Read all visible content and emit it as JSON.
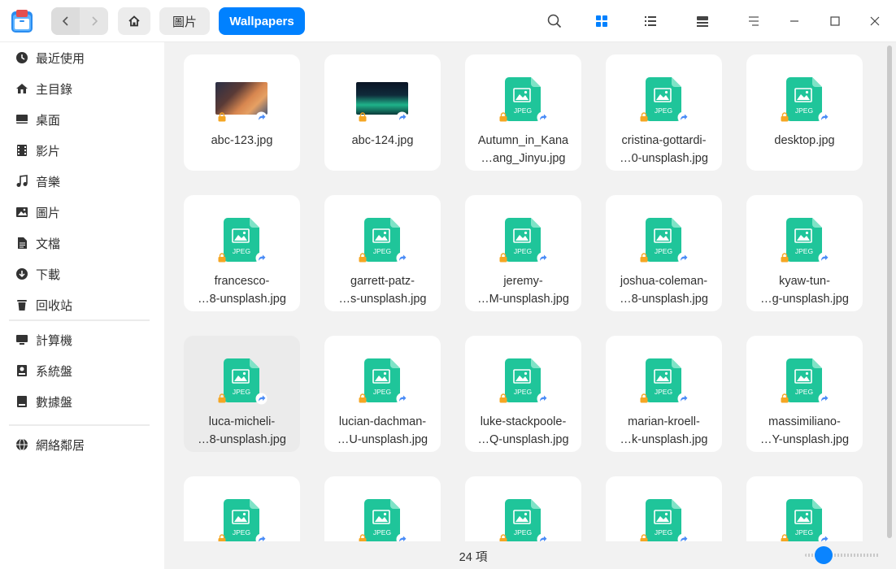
{
  "breadcrumb": {
    "parent": "圖片",
    "current": "Wallpapers"
  },
  "sidebar": {
    "group1": [
      {
        "label": "最近使用",
        "icon": "clock-icon"
      },
      {
        "label": "主目錄",
        "icon": "home-icon"
      },
      {
        "label": "桌面",
        "icon": "desktop-icon"
      },
      {
        "label": "影片",
        "icon": "video-icon"
      },
      {
        "label": "音樂",
        "icon": "music-icon"
      },
      {
        "label": "圖片",
        "icon": "picture-icon"
      },
      {
        "label": "文檔",
        "icon": "document-icon"
      },
      {
        "label": "下載",
        "icon": "download-icon"
      },
      {
        "label": "回收站",
        "icon": "trash-icon"
      }
    ],
    "group2": [
      {
        "label": "計算機",
        "icon": "computer-icon"
      },
      {
        "label": "系統盤",
        "icon": "system-disk-icon"
      },
      {
        "label": "數據盤",
        "icon": "data-disk-icon"
      }
    ],
    "group3": [
      {
        "label": "網絡鄰居",
        "icon": "network-icon"
      }
    ]
  },
  "files": [
    {
      "line1": "abc-123.jpg",
      "line2": "",
      "thumb": "image"
    },
    {
      "line1": "abc-124.jpg",
      "line2": "",
      "thumb": "image"
    },
    {
      "line1": "Autumn_in_Kana",
      "line2": "…ang_Jinyu.jpg",
      "thumb": "jpeg"
    },
    {
      "line1": "cristina-gottardi-",
      "line2": "…0-unsplash.jpg",
      "thumb": "jpeg"
    },
    {
      "line1": "desktop.jpg",
      "line2": "",
      "thumb": "jpeg"
    },
    {
      "line1": "francesco-",
      "line2": "…8-unsplash.jpg",
      "thumb": "jpeg"
    },
    {
      "line1": "garrett-patz-",
      "line2": "…s-unsplash.jpg",
      "thumb": "jpeg"
    },
    {
      "line1": "jeremy-",
      "line2": "…M-unsplash.jpg",
      "thumb": "jpeg"
    },
    {
      "line1": "joshua-coleman-",
      "line2": "…8-unsplash.jpg",
      "thumb": "jpeg"
    },
    {
      "line1": "kyaw-tun-",
      "line2": "…g-unsplash.jpg",
      "thumb": "jpeg"
    },
    {
      "line1": "luca-micheli-",
      "line2": "…8-unsplash.jpg",
      "thumb": "jpeg"
    },
    {
      "line1": "lucian-dachman-",
      "line2": "…U-unsplash.jpg",
      "thumb": "jpeg"
    },
    {
      "line1": "luke-stackpoole-",
      "line2": "…Q-unsplash.jpg",
      "thumb": "jpeg"
    },
    {
      "line1": "marian-kroell-",
      "line2": "…k-unsplash.jpg",
      "thumb": "jpeg"
    },
    {
      "line1": "massimiliano-",
      "line2": "…Y-unsplash.jpg",
      "thumb": "jpeg"
    },
    {
      "line1": "",
      "line2": "",
      "thumb": "jpeg"
    },
    {
      "line1": "",
      "line2": "",
      "thumb": "jpeg"
    },
    {
      "line1": "",
      "line2": "",
      "thumb": "jpeg"
    },
    {
      "line1": "",
      "line2": "",
      "thumb": "jpeg"
    },
    {
      "line1": "",
      "line2": "",
      "thumb": "jpeg"
    }
  ],
  "jpeg_label": "JPEG",
  "selected_index": 10,
  "status": {
    "item_count": "24 項"
  },
  "icon_size_slider": {
    "value_fraction": 0.25
  },
  "colors": {
    "accent": "#0081ff",
    "jpeg_green": "#1fc59a",
    "lock": "#f5a623"
  }
}
